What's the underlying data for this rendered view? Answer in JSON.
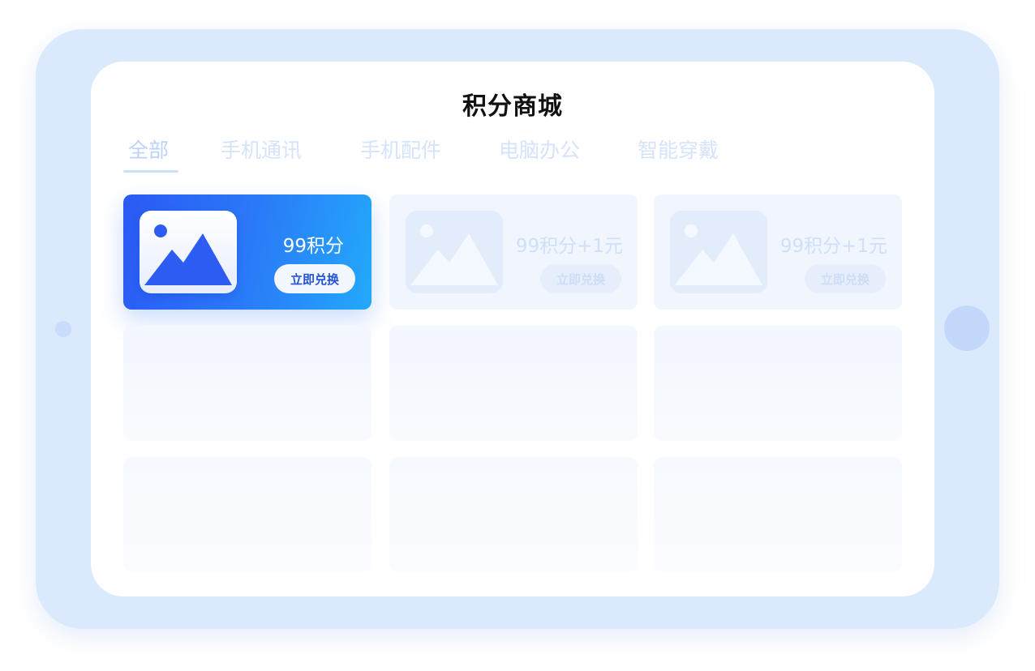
{
  "page": {
    "title": "积分商城"
  },
  "tabs": [
    {
      "label": "全部",
      "active": true
    },
    {
      "label": "手机通讯",
      "active": false
    },
    {
      "label": "手机配件",
      "active": false
    },
    {
      "label": "电脑办公",
      "active": false
    },
    {
      "label": "智能穿戴",
      "active": false
    }
  ],
  "products": [
    {
      "points": "99积分",
      "button_label": "立即兑换",
      "image_icon": "image-placeholder-icon",
      "highlighted": true
    },
    {
      "points": "99积分+1元",
      "button_label": "立即兑换",
      "image_icon": "image-placeholder-icon",
      "highlighted": false
    },
    {
      "points": "99积分+1元",
      "button_label": "立即兑换",
      "image_icon": "image-placeholder-icon",
      "highlighted": false
    }
  ],
  "colors": {
    "accent": "#2b6cf7",
    "accent_light": "#23a9fb",
    "frame": "#dbe9fd",
    "placeholder": "#f3f7fe"
  }
}
